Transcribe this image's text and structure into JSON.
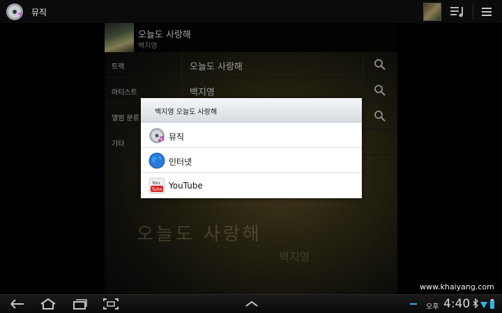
{
  "action_bar": {
    "app_title": "뮤직"
  },
  "now_playing": {
    "title": "오늘도 사랑해",
    "artist": "백지영"
  },
  "search": {
    "rows": [
      {
        "label": "트랙",
        "value": "오늘도 사랑해"
      },
      {
        "label": "아티스트",
        "value": "백지영"
      },
      {
        "label": "앨범 분류",
        "value": ""
      },
      {
        "label": "기타",
        "value": ""
      }
    ]
  },
  "album_art_text": {
    "line1": "오늘도 사랑해",
    "line2": "백지영"
  },
  "dialog": {
    "title": "백지영 오늘도 사랑해",
    "items": [
      {
        "label": "뮤직",
        "icon": "music-disc-icon"
      },
      {
        "label": "인터넷",
        "icon": "globe-icon"
      },
      {
        "label": "YouTube",
        "icon": "youtube-icon"
      }
    ]
  },
  "watermark": "www.khaiyang.com",
  "system_bar": {
    "ampm": "오후",
    "time": "4:40"
  },
  "colors": {
    "accent_blue": "#33b5e5",
    "dialog_header": "#dfe4e8"
  }
}
